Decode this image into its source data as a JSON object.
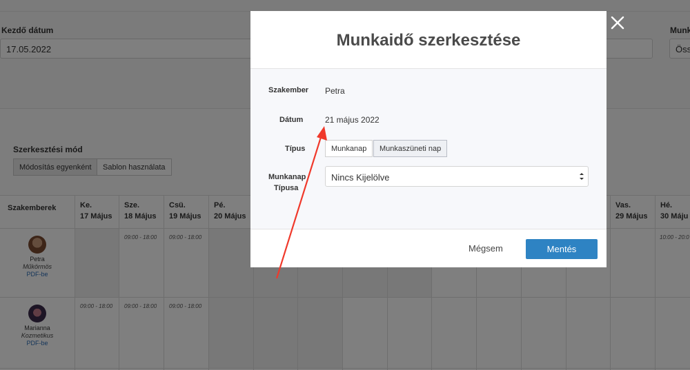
{
  "background": {
    "start_date_label": "Kezdő dátum",
    "start_date_value": "17.05.2022",
    "right_label_partial": "Munk",
    "right_value_partial": "Öss",
    "edit_mode_label": "Szerkesztési mód",
    "edit_mode_options": [
      "Módosítás egyenként",
      "Sablon használata"
    ],
    "table": {
      "first_column_header": "Szakemberek",
      "day_headers": [
        {
          "day": "Ke.",
          "date": "17 Május"
        },
        {
          "day": "Sze.",
          "date": "18 Május"
        },
        {
          "day": "Csü.",
          "date": "19 Május"
        },
        {
          "day": "Pé.",
          "date": "20 Május"
        },
        {
          "day": "Vas.",
          "date": "29 Május"
        },
        {
          "day": "Hé.",
          "date": "30 Máju"
        }
      ],
      "rows": [
        {
          "name": "Petra",
          "role": "Műkörmös",
          "pdf": "PDF-be",
          "times": [
            "09:00 - 18:00",
            "09:00 - 18:00",
            "10:00 - 20:0"
          ]
        },
        {
          "name": "Marianna",
          "role": "Kozmetikus",
          "pdf": "PDF-be",
          "times": [
            "09:00 - 18:00",
            "09:00 - 18:00",
            "09:00 - 18:00"
          ]
        }
      ]
    }
  },
  "modal": {
    "title": "Munkaidő szerkesztése",
    "specialist_label": "Szakember",
    "specialist_value": "Petra",
    "date_label": "Dátum",
    "date_value": "21 május 2022",
    "type_label": "Típus",
    "type_options": [
      "Munkanap",
      "Munkaszüneti nap"
    ],
    "type_selected": "Munkaszüneti nap",
    "workday_type_label_line1": "Munkanap",
    "workday_type_label_line2": "Típusa",
    "workday_type_value": "Nincs Kijelölve",
    "cancel_label": "Mégsem",
    "save_label": "Mentés"
  },
  "colors": {
    "accent": "#2e83c3",
    "annotation_arrow": "#f0392b",
    "overlay": "rgba(0,0,0,0.5)"
  },
  "icons": [
    "close-icon",
    "select-arrows-icon",
    "annotation-arrow"
  ]
}
